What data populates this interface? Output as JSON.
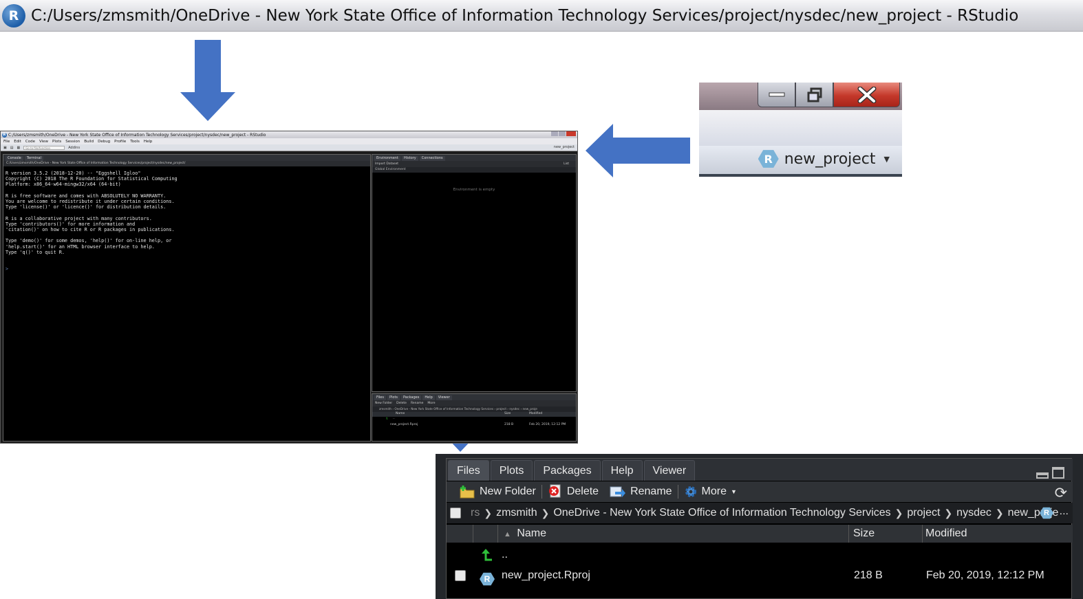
{
  "window_title": "C:/Users/zmsmith/OneDrive - New York State Office of Information Technology Services/project/nysdec/new_project - RStudio",
  "project_menu": {
    "label": "new_project"
  },
  "mini": {
    "menus": [
      "File",
      "Edit",
      "Code",
      "View",
      "Plots",
      "Session",
      "Build",
      "Debug",
      "Profile",
      "Tools",
      "Help"
    ],
    "goto_placeholder": "Go to file/function",
    "addins": "Addins",
    "console_tabs": [
      "Console",
      "Terminal"
    ],
    "console_path": "C:/Users/zmsmith/OneDrive - New York State Office of Information Technology Services/project/nysdec/new_project/",
    "console_text": "R version 3.5.2 (2018-12-20) -- \"Eggshell Igloo\"\nCopyright (C) 2018 The R Foundation for Statistical Computing\nPlatform: x86_64-w64-mingw32/x64 (64-bit)\n\nR is free software and comes with ABSOLUTELY NO WARRANTY.\nYou are welcome to redistribute it under certain conditions.\nType 'license()' or 'licence()' for distribution details.\n\nR is a collaborative project with many contributors.\nType 'contributors()' for more information and\n'citation()' on how to cite R or R packages in publications.\n\nType 'demo()' for some demos, 'help()' for on-line help, or\n'help.start()' for an HTML browser interface to help.\nType 'q()' to quit R.",
    "prompt": ">",
    "env_tabs": [
      "Environment",
      "History",
      "Connections"
    ],
    "import_dataset": "Import Dataset",
    "list_view": "List",
    "global_env": "Global Environment",
    "env_empty": "Environment is empty"
  },
  "files": {
    "tabs": [
      "Files",
      "Plots",
      "Packages",
      "Help",
      "Viewer"
    ],
    "toolbar": {
      "new_folder": "New Folder",
      "delete": "Delete",
      "rename": "Rename",
      "more": "More"
    },
    "breadcrumb": {
      "lead": "rs",
      "parts": [
        "zmsmith",
        "OneDrive - New York State Office of Information Technology Services",
        "project",
        "nysdec",
        "new_proje"
      ],
      "more": "..."
    },
    "columns": {
      "name": "Name",
      "size": "Size",
      "modified": "Modified"
    },
    "up_label": "..",
    "file": {
      "name": "new_project.Rproj",
      "size": "218 B",
      "modified": "Feb 20, 2019, 12:12 PM"
    }
  },
  "colors": {
    "arrow": "#4472c4",
    "r_blue": "#1e5ea8",
    "close_red": "#c4382a"
  }
}
